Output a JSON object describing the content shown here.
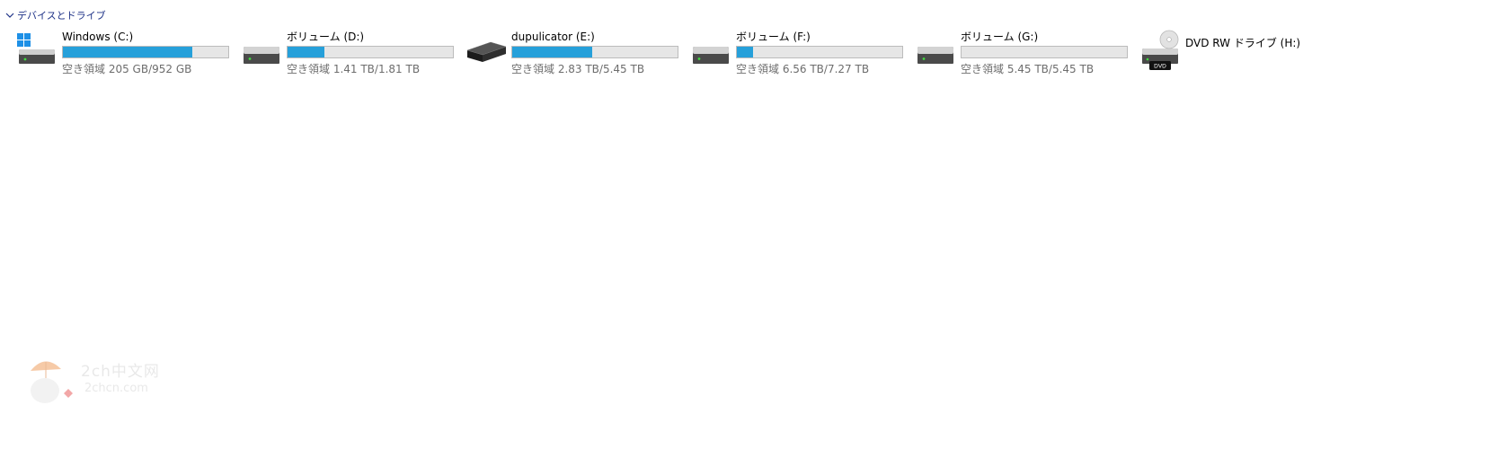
{
  "group": {
    "title": "デバイスとドライブ"
  },
  "drives": [
    {
      "name": "Windows (C:)",
      "icon": "windows-system-drive-icon",
      "free_text": "空き領域 205 GB/952 GB",
      "used_fraction": 0.785
    },
    {
      "name": "ボリューム (D:)",
      "icon": "hard-drive-icon",
      "free_text": "空き領域 1.41 TB/1.81 TB",
      "used_fraction": 0.221
    },
    {
      "name": "dupulicator (E:)",
      "icon": "external-drive-icon",
      "free_text": "空き領域 2.83 TB/5.45 TB",
      "used_fraction": 0.481
    },
    {
      "name": "ボリューム (F:)",
      "icon": "hard-drive-icon",
      "free_text": "空き領域 6.56 TB/7.27 TB",
      "used_fraction": 0.098
    },
    {
      "name": "ボリューム (G:)",
      "icon": "hard-drive-icon",
      "free_text": "空き領域 5.45 TB/5.45 TB",
      "used_fraction": 0.0
    },
    {
      "name": "DVD RW ドライブ (H:)",
      "icon": "dvd-drive-icon"
    }
  ],
  "colors": {
    "bar_fill": "#26a0da",
    "bar_bg": "#e6e6e6",
    "header_text": "#1e3287"
  },
  "watermark": {
    "text_main": "2ch中文网",
    "text_sub": "2chcn.com"
  }
}
